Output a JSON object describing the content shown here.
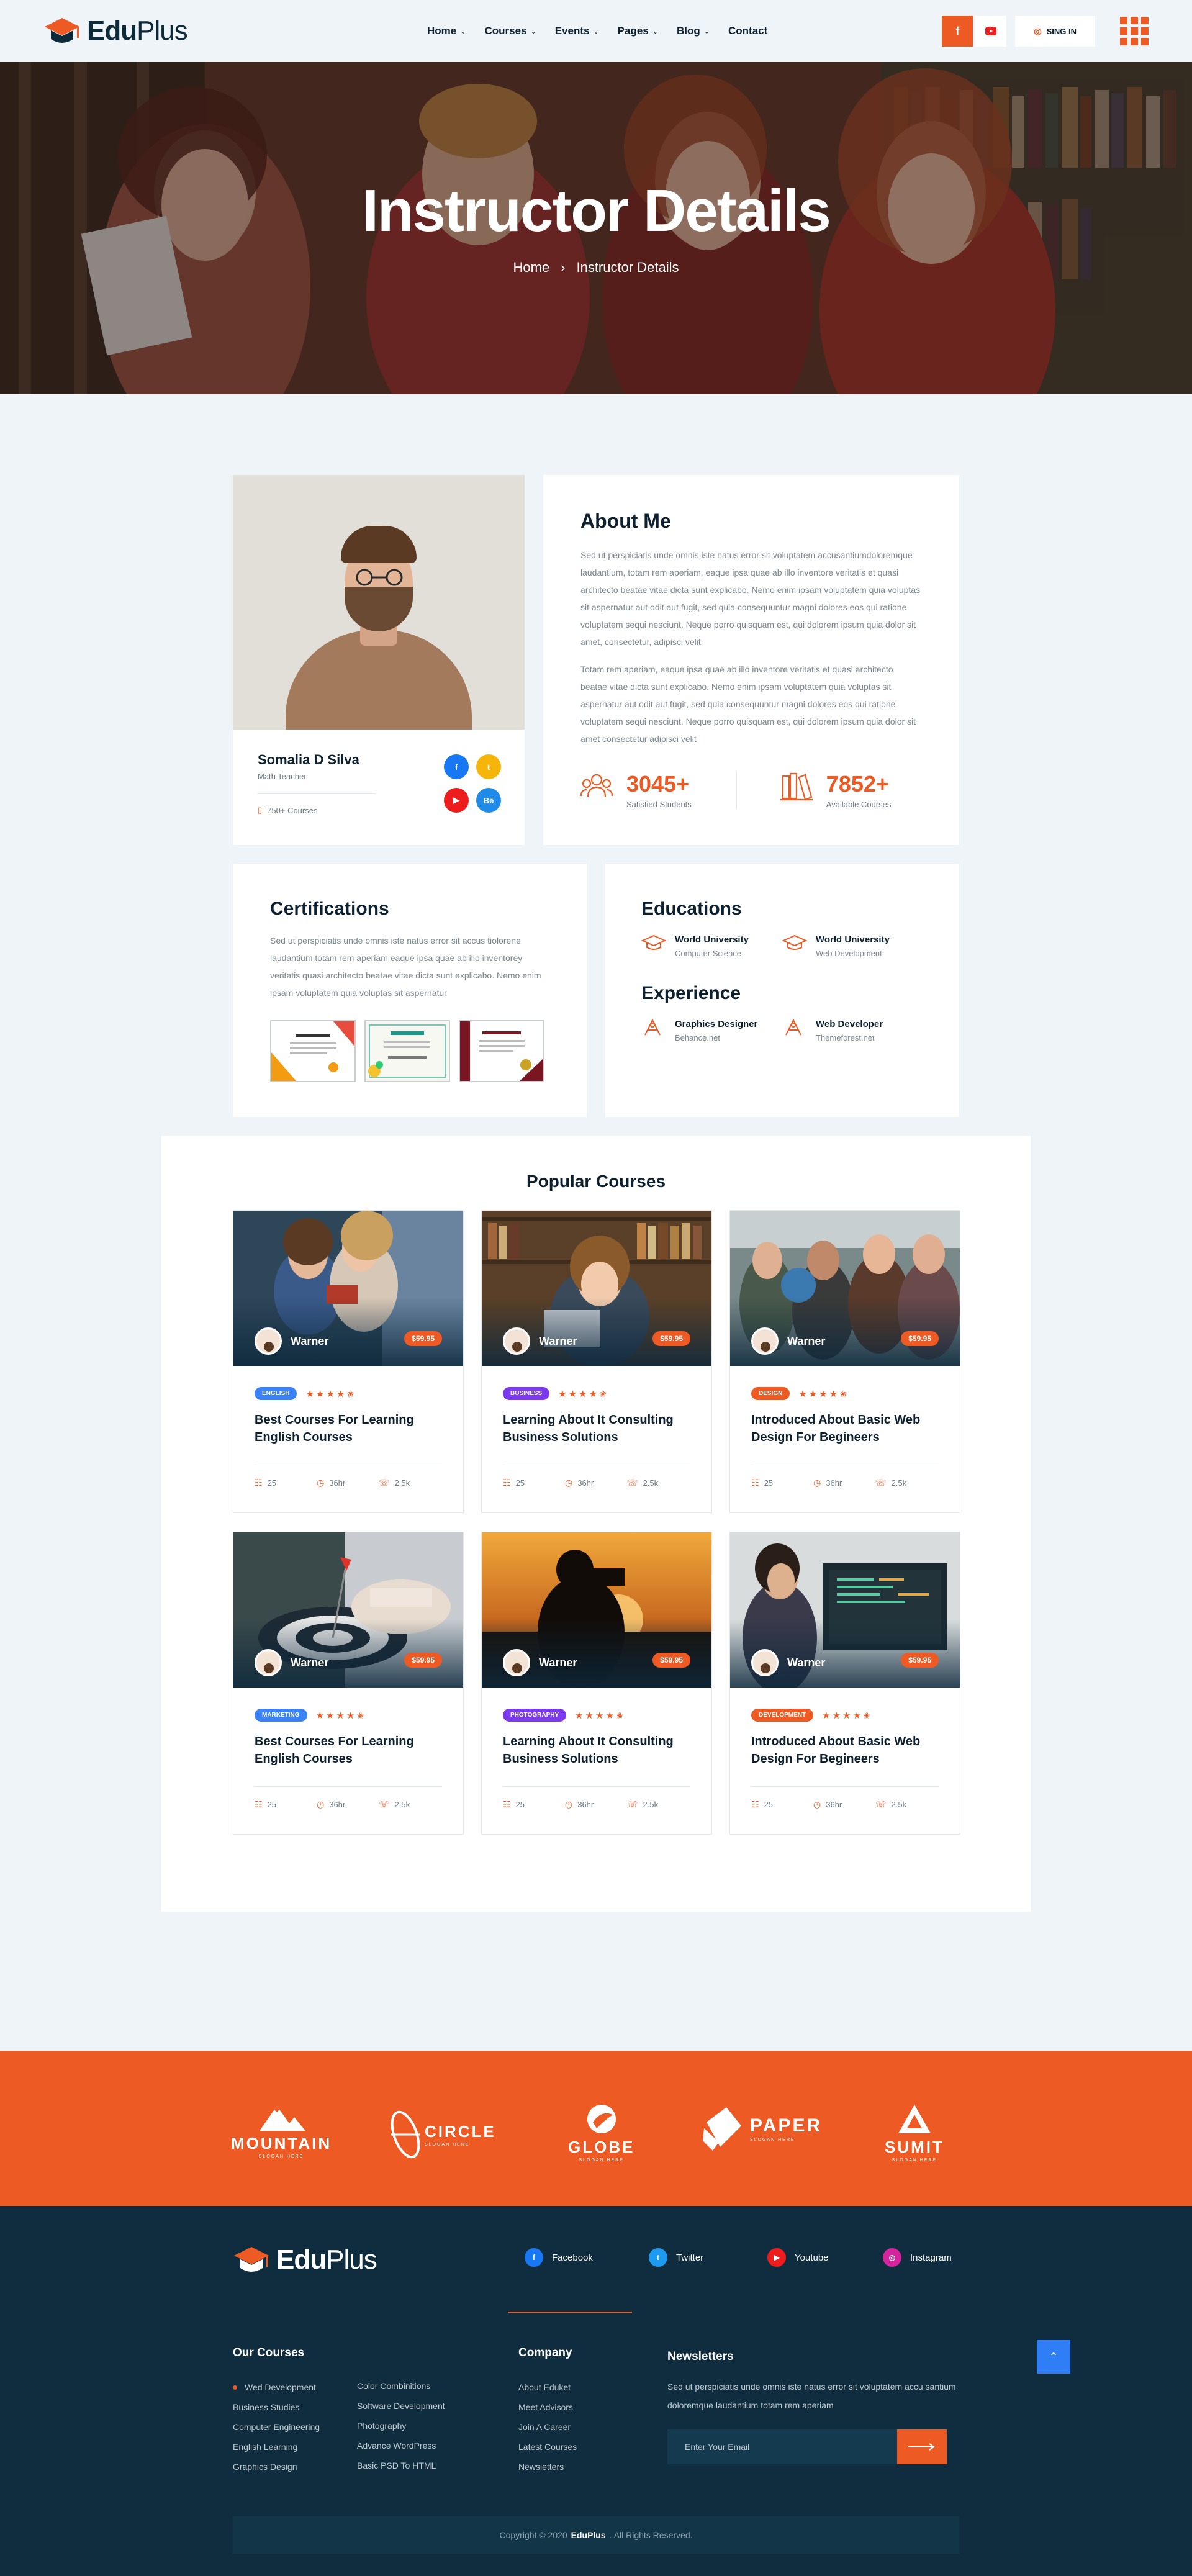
{
  "header": {
    "logo_main": "Edu",
    "logo_plus": "Plus",
    "nav": [
      {
        "label": "Home",
        "has_dropdown": true
      },
      {
        "label": "Courses",
        "has_dropdown": true
      },
      {
        "label": "Events",
        "has_dropdown": true
      },
      {
        "label": "Pages",
        "has_dropdown": true
      },
      {
        "label": "Blog",
        "has_dropdown": true
      },
      {
        "label": "Contact",
        "has_dropdown": false
      }
    ],
    "facebook": "f",
    "signin_label": "SING IN"
  },
  "hero": {
    "title": "Instructor Details",
    "breadcrumb_home": "Home",
    "breadcrumb_sep": "›",
    "breadcrumb_current": "Instructor Details"
  },
  "instructor": {
    "name": "Somalia D Silva",
    "role": "Math Teacher",
    "courses": "750+ Courses",
    "social": [
      {
        "icon": "facebook-icon",
        "glyph": "f",
        "color": "#1877f2"
      },
      {
        "icon": "twitter-icon",
        "glyph": "t",
        "color": "#f5b50a"
      },
      {
        "icon": "youtube-icon",
        "glyph": "▶",
        "color": "#ee1d1d"
      },
      {
        "icon": "behance-icon",
        "glyph": "Bē",
        "color": "#1f8ae8"
      }
    ]
  },
  "about": {
    "title": "About Me",
    "paragraph1": "Sed ut perspiciatis unde omnis iste natus error sit voluptatem accusantiumdoloremque laudantium, totam rem aperiam, eaque ipsa quae ab illo inventore veritatis et quasi architecto beatae vitae dicta sunt explicabo. Nemo enim ipsam voluptatem quia voluptas sit aspernatur aut odit aut fugit, sed quia consequuntur magni dolores eos qui ratione voluptatem sequi nesciunt. Neque porro quisquam est, qui dolorem ipsum quia dolor sit amet, consectetur, adipisci velit",
    "paragraph2": "Totam rem aperiam, eaque ipsa quae ab illo inventore veritatis et quasi architecto beatae vitae dicta sunt explicabo. Nemo enim ipsam voluptatem quia voluptas sit aspernatur aut odit aut fugit, sed quia consequuntur magni dolores eos qui ratione voluptatem sequi nesciunt. Neque porro quisquam est, qui dolorem ipsum quia dolor sit amet consectetur adipisci velit",
    "stats": [
      {
        "value": "3045+",
        "label": "Satisfied Students",
        "icon": "students-icon"
      },
      {
        "value": "7852+",
        "label": "Available Courses",
        "icon": "books-icon"
      }
    ]
  },
  "certifications": {
    "title": "Certifications",
    "text": "Sed ut perspiciatis unde omnis iste natus error sit accus tiolorene laudantium totam rem aperiam eaque ipsa quae ab illo inventorey veritatis quasi architecto beatae vitae dicta sunt explicabo. Nemo enim ipsam voluptatem quia voluptas sit aspernatur"
  },
  "educations": {
    "title": "Educations",
    "items": [
      {
        "title": "World University",
        "subtitle": "Computer Science"
      },
      {
        "title": "World University",
        "subtitle": "Web Development"
      }
    ]
  },
  "experience": {
    "title": "Experience",
    "items": [
      {
        "title": "Graphics Designer",
        "subtitle": "Behance.net"
      },
      {
        "title": "Web Developer",
        "subtitle": "Themeforest.net"
      }
    ]
  },
  "courses": {
    "title": "Popular Courses",
    "items": [
      {
        "author": "Warner",
        "price": "$59.95",
        "tag": "ENGLISH",
        "tag_color": "#3b82f6",
        "title": "Best Courses For Learning English Courses",
        "lessons": "25",
        "duration": "36hr",
        "comments": "2.5k",
        "scene": 0
      },
      {
        "author": "Warner",
        "price": "$59.95",
        "tag": "BUSINESS",
        "tag_color": "#7c3aed",
        "title": "Learning About It Consulting Business Solutions",
        "lessons": "25",
        "duration": "36hr",
        "comments": "2.5k",
        "scene": 1
      },
      {
        "author": "Warner",
        "price": "$59.95",
        "tag": "DESIGN",
        "tag_color": "#ee5a24",
        "title": "Introduced About Basic Web Design For Begineers",
        "lessons": "25",
        "duration": "36hr",
        "comments": "2.5k",
        "scene": 2
      },
      {
        "author": "Warner",
        "price": "$59.95",
        "tag": "MARKETING",
        "tag_color": "#3b82f6",
        "title": "Best Courses For Learning English Courses",
        "lessons": "25",
        "duration": "36hr",
        "comments": "2.5k",
        "scene": 3
      },
      {
        "author": "Warner",
        "price": "$59.95",
        "tag": "PHOTOGRAPHY",
        "tag_color": "#7c3aed",
        "title": "Learning About It Consulting Business Solutions",
        "lessons": "25",
        "duration": "36hr",
        "comments": "2.5k",
        "scene": 4
      },
      {
        "author": "Warner",
        "price": "$59.95",
        "tag": "DEVELOPMENT",
        "tag_color": "#ee5a24",
        "title": "Introduced About Basic Web Design For Begineers",
        "lessons": "25",
        "duration": "36hr",
        "comments": "2.5k",
        "scene": 5
      }
    ],
    "stars": "★★★★✬"
  },
  "brands": [
    {
      "name": "MOUNTAIN",
      "slogan": "SLOGAN HERE"
    },
    {
      "name": "CIRCLE",
      "slogan": "SLOGAN HERE"
    },
    {
      "name": "GLOBE",
      "slogan": "SLOGAN HERE"
    },
    {
      "name": "PAPER",
      "slogan": "SLOGAN HERE"
    },
    {
      "name": "SUMIT",
      "slogan": "SLOGAN HERE"
    }
  ],
  "footer": {
    "logo_main": "Edu",
    "logo_plus": "Plus",
    "social": [
      {
        "label": "Facebook",
        "icon": "facebook-icon",
        "glyph": "f",
        "color": "#1877f2"
      },
      {
        "label": "Twitter",
        "icon": "twitter-icon",
        "glyph": "t",
        "color": "#1d9bf0"
      },
      {
        "label": "Youtube",
        "icon": "youtube-icon",
        "glyph": "▶",
        "color": "#ee1d1d"
      },
      {
        "label": "Instagram",
        "icon": "instagram-icon",
        "glyph": "◎",
        "color": "#d6249f"
      }
    ],
    "our_courses_title": "Our Courses",
    "our_courses_col1": [
      "Wed Development",
      "Business Studies",
      "Computer Engineering",
      "English Learning",
      "Graphics Design"
    ],
    "our_courses_col2": [
      "Color Combinitions",
      "Software Development",
      "Photography",
      "Advance WordPress",
      "Basic PSD To HTML"
    ],
    "company_title": "Company",
    "company_links": [
      "About Eduket",
      "Meet Advisors",
      "Join A Career",
      "Latest Courses",
      "Newsletters"
    ],
    "newsletter_title": "Newsletters",
    "newsletter_text": "Sed ut perspiciatis unde omnis iste natus error sit voluptatem accu santium doloremque laudantium totam rem aperiam",
    "email_placeholder": "Enter Your Email",
    "copyright_prefix": "Copyright © 2020",
    "copyright_brand": "EduPlus",
    "copyright_suffix": ". All Rights Reserved."
  }
}
